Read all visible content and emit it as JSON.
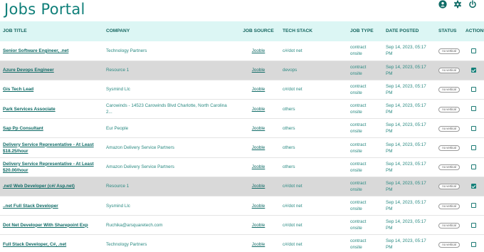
{
  "app": {
    "title": "Jobs Portal"
  },
  "header_icons": [
    "user-icon",
    "gear-icon",
    "power-icon"
  ],
  "columns": {
    "title": "JOB TITLE",
    "company": "COMPANY",
    "source": "JOB SOURCE",
    "tech": "TECH STACK",
    "type": "JOB TYPE",
    "date": "DATE POSTED",
    "status": "STATUS",
    "actions": "ACTIONS"
  },
  "rows": [
    {
      "title": "Senior Software Engineer, .net",
      "company": "Technology Partners",
      "source": "Jooble",
      "tech": "c#/dot net",
      "type_line1": "contract",
      "type_line2": "onsite",
      "date_line1": "Sep 14, 2023, 05:17",
      "date_line2": "PM",
      "status": "no vertical",
      "checked": false,
      "highlighted": false
    },
    {
      "title": "Azure Devops Engineer",
      "company": "Resource 1",
      "source": "Jooble",
      "tech": "devops",
      "type_line1": "contract",
      "type_line2": "onsite",
      "date_line1": "Sep 14, 2023, 05:17",
      "date_line2": "PM",
      "status": "no vertical",
      "checked": true,
      "highlighted": true
    },
    {
      "title": "Gis Tech Lead",
      "company": "Sysmind Llc",
      "source": "Jooble",
      "tech": "c#/dot net",
      "type_line1": "contract",
      "type_line2": "onsite",
      "date_line1": "Sep 14, 2023, 05:17",
      "date_line2": "PM",
      "status": "no vertical",
      "checked": false,
      "highlighted": false
    },
    {
      "title": "Park Services Associate",
      "company": "Carowinds - 14523 Carowinds Blvd Charlotte, North Carolina 2...",
      "source": "Jooble",
      "tech": "others",
      "type_line1": "contract",
      "type_line2": "onsite",
      "date_line1": "Sep 14, 2023, 05:17",
      "date_line2": "PM",
      "status": "no vertical",
      "checked": false,
      "highlighted": false
    },
    {
      "title": "Sap Pp Consultant",
      "company": "Eur People",
      "source": "Jooble",
      "tech": "others",
      "type_line1": "contract",
      "type_line2": "onsite",
      "date_line1": "Sep 14, 2023, 05:17",
      "date_line2": "PM",
      "status": "no vertical",
      "checked": false,
      "highlighted": false
    },
    {
      "title": "Delivery Service Representative - At Least $18.25/hour",
      "company": "Amazon Delivery Service Partners",
      "source": "Jooble",
      "tech": "others",
      "type_line1": "contract",
      "type_line2": "onsite",
      "date_line1": "Sep 14, 2023, 05:17",
      "date_line2": "PM",
      "status": "no vertical",
      "checked": false,
      "highlighted": false
    },
    {
      "title": "Delivery Service Representative - At Least $20.00/hour",
      "company": "Amazon Delivery Service Partners",
      "source": "Jooble",
      "tech": "others",
      "type_line1": "contract",
      "type_line2": "onsite",
      "date_line1": "Sep 14, 2023, 05:17",
      "date_line2": "PM",
      "status": "no vertical",
      "checked": false,
      "highlighted": false
    },
    {
      "title": ".net/ Web Developer (c#/ Asp.net)",
      "company": "Resource 1",
      "source": "Jooble",
      "tech": "c#/dot net",
      "type_line1": "contract",
      "type_line2": "onsite",
      "date_line1": "Sep 14, 2023, 05:17",
      "date_line2": "PM",
      "status": "no vertical",
      "checked": true,
      "highlighted": true
    },
    {
      "title": "..net Full Stack Developer",
      "company": "Sysmind Llc",
      "source": "Jooble",
      "tech": "c#/dot net",
      "type_line1": "contract",
      "type_line2": "onsite",
      "date_line1": "Sep 14, 2023, 05:17",
      "date_line2": "PM",
      "status": "no vertical",
      "checked": false,
      "highlighted": false
    },
    {
      "title": "Dot Net Developer With Sharepoint Exp",
      "company": "Ruchika@arsquaretech.com",
      "source": "Jooble",
      "tech": "c#/dot net",
      "type_line1": "contract",
      "type_line2": "onsite",
      "date_line1": "Sep 14, 2023, 05:17",
      "date_line2": "PM",
      "status": "no vertical",
      "checked": false,
      "highlighted": false
    },
    {
      "title": "Full Stack Developer, C#, .net",
      "company": "Technology Partners",
      "source": "Jooble",
      "tech": "c#/dot net",
      "type_line1": "contract",
      "type_line2": "onsite",
      "date_line1": "Sep 14, 2023, 05:17",
      "date_line2": "PM",
      "status": "no vertical",
      "checked": false,
      "highlighted": false
    }
  ]
}
